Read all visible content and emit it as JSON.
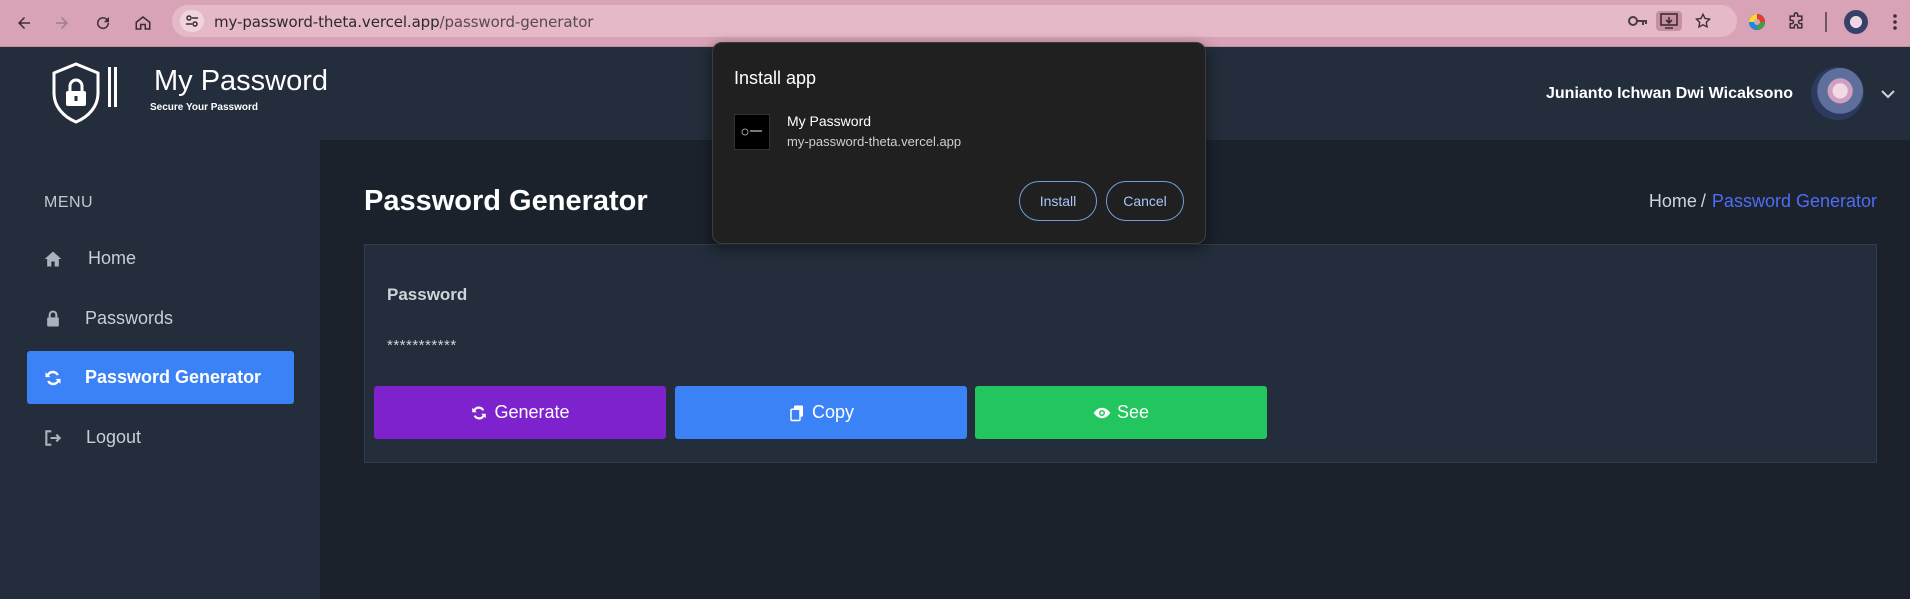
{
  "browser": {
    "url_host": "my-password-theta.vercel.app",
    "url_path": "/password-generator"
  },
  "header": {
    "logo_title": "My Password",
    "logo_subtitle": "Secure Your Password",
    "user_name": "Junianto Ichwan Dwi Wicaksono"
  },
  "sidebar": {
    "menu_label": "MENU",
    "items": [
      {
        "label": "Home",
        "icon": "home-icon"
      },
      {
        "label": "Passwords",
        "icon": "lock-icon"
      },
      {
        "label": "Password Generator",
        "icon": "refresh-icon",
        "active": true
      },
      {
        "label": "Logout",
        "icon": "logout-icon"
      }
    ]
  },
  "main": {
    "title": "Password Generator",
    "breadcrumb": {
      "home": "Home",
      "separator": "/",
      "current": "Password Generator"
    },
    "card": {
      "label": "Password",
      "value": "***********",
      "buttons": {
        "generate": "Generate",
        "copy": "Copy",
        "see": "See"
      }
    }
  },
  "install_popup": {
    "title": "Install app",
    "app_name": "My Password",
    "app_url": "my-password-theta.vercel.app",
    "install_label": "Install",
    "cancel_label": "Cancel"
  },
  "colors": {
    "active_nav": "#3b82f6",
    "generate": "#7e22ce",
    "copy": "#3b82f6",
    "see": "#22c55e",
    "breadcrumb_current": "#4f6df5",
    "browser_bar": "#d8a3b6"
  }
}
